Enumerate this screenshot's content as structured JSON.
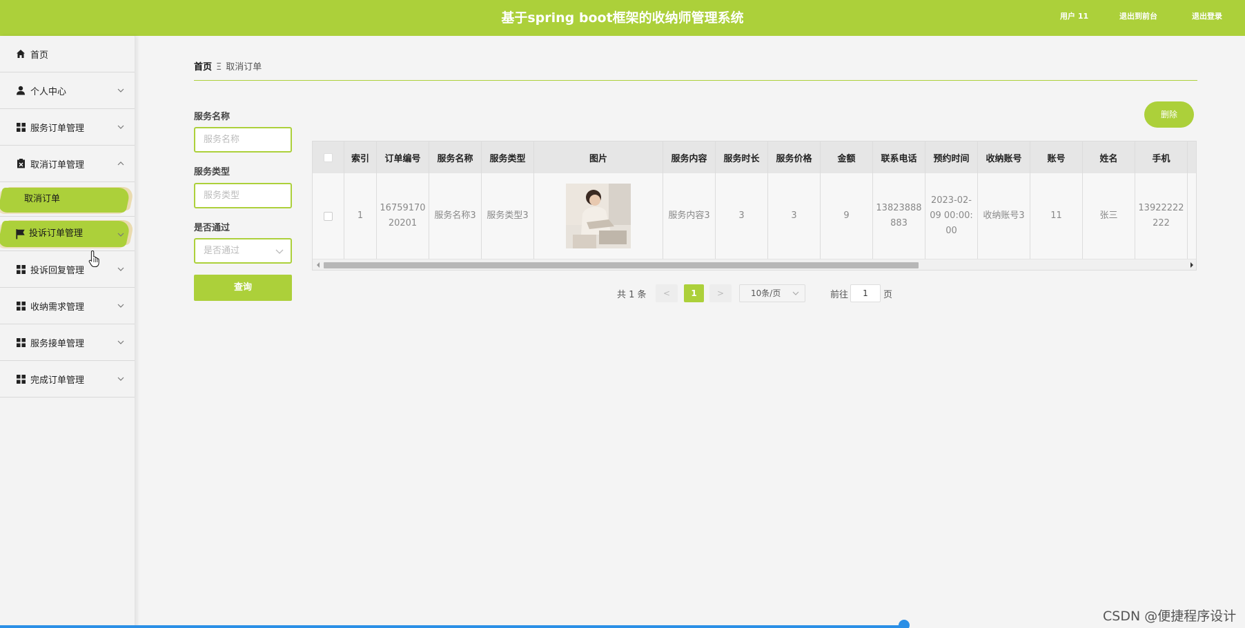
{
  "header": {
    "title": "基于spring boot框架的收纳师管理系统",
    "user": "用户 11",
    "back_to_front": "退出到前台",
    "logout": "退出登录"
  },
  "sidebar": {
    "items": [
      {
        "label": "首页",
        "icon": "home-icon"
      },
      {
        "label": "个人中心",
        "icon": "user-icon"
      },
      {
        "label": "服务订单管理",
        "icon": "grid-icon"
      },
      {
        "label": "取消订单管理",
        "icon": "cancel-doc-icon",
        "expanded": true
      },
      {
        "label": "取消订单",
        "active": true
      },
      {
        "label": "投诉订单管理",
        "icon": "flag-icon",
        "highlighted": true
      },
      {
        "label": "投诉回复管理",
        "icon": "grid-icon"
      },
      {
        "label": "收纳需求管理",
        "icon": "grid-icon"
      },
      {
        "label": "服务接单管理",
        "icon": "grid-icon"
      },
      {
        "label": "完成订单管理",
        "icon": "grid-icon"
      }
    ]
  },
  "breadcrumb": {
    "home": "首页",
    "separator": "Ξ",
    "current": "取消订单"
  },
  "search": {
    "service_name_label": "服务名称",
    "service_name_placeholder": "服务名称",
    "service_type_label": "服务类型",
    "service_type_placeholder": "服务类型",
    "approved_label": "是否通过",
    "approved_placeholder": "是否通过",
    "query_button": "查询"
  },
  "toolbar": {
    "delete_button": "删除"
  },
  "table": {
    "headers": [
      "",
      "索引",
      "订单编号",
      "服务名称",
      "服务类型",
      "图片",
      "服务内容",
      "服务时长",
      "服务价格",
      "金额",
      "联系电话",
      "预约时间",
      "收纳账号",
      "账号",
      "姓名",
      "手机"
    ],
    "rows": [
      [
        "",
        "1",
        "1675917020201",
        "服务名称3",
        "服务类型3",
        "",
        "服务内容3",
        "3",
        "3",
        "9",
        "13823888883",
        "2023-02-09 00:00:00",
        "收纳账号3",
        "11",
        "张三",
        "13922222222"
      ]
    ]
  },
  "pagination": {
    "total": "共 1 条",
    "prev": "<",
    "current_page": "1",
    "next": ">",
    "page_size": "10条/页",
    "goto_label": "前往",
    "goto_value": "1",
    "page_unit": "页"
  },
  "watermark": "CSDN @便捷程序设计",
  "colors": {
    "accent": "#acd03a",
    "progress": "#2b8fe6"
  }
}
